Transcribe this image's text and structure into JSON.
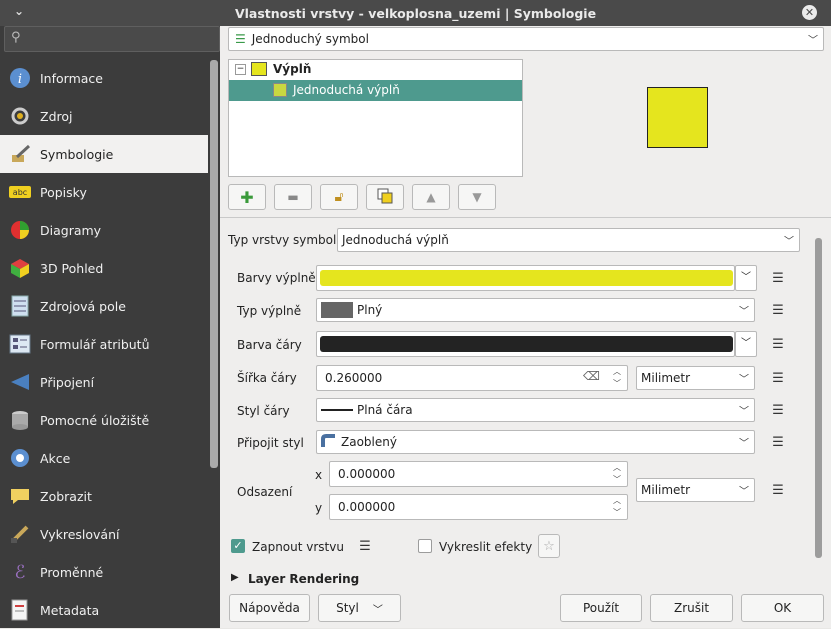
{
  "window": {
    "title": "Vlastnosti vrstvy - velkoplosna_uzemi | Symbologie"
  },
  "sidebar": {
    "items": [
      {
        "label": "Informace",
        "icon": "info-icon"
      },
      {
        "label": "Zdroj",
        "icon": "source-icon"
      },
      {
        "label": "Symbologie",
        "icon": "symbology-icon"
      },
      {
        "label": "Popisky",
        "icon": "labels-icon"
      },
      {
        "label": "Diagramy",
        "icon": "diagrams-icon"
      },
      {
        "label": "3D Pohled",
        "icon": "cube-3d-icon"
      },
      {
        "label": "Zdrojová pole",
        "icon": "fields-icon"
      },
      {
        "label": "Formulář atributů",
        "icon": "attributes-form-icon"
      },
      {
        "label": "Připojení",
        "icon": "joins-icon"
      },
      {
        "label": "Pomocné úložiště",
        "icon": "auxiliary-storage-icon"
      },
      {
        "label": "Akce",
        "icon": "actions-icon"
      },
      {
        "label": "Zobrazit",
        "icon": "display-icon"
      },
      {
        "label": "Vykreslování",
        "icon": "rendering-icon"
      },
      {
        "label": "Proměnné",
        "icon": "variables-icon"
      },
      {
        "label": "Metadata",
        "icon": "metadata-icon"
      }
    ],
    "active": "Symbologie"
  },
  "renderer": {
    "selected": "Jednoduchý symbol"
  },
  "tree": {
    "root": "Výplň",
    "child": "Jednoduchá výplň"
  },
  "symbol_type": {
    "label": "Typ vrstvy symbolů",
    "value": "Jednoduchá výplň"
  },
  "props": {
    "fill_color": {
      "label": "Barvy výplně",
      "color": "#e5e51e"
    },
    "fill_style": {
      "label": "Typ výplně",
      "value": "Plný"
    },
    "stroke_color": {
      "label": "Barva čáry",
      "color": "#232323"
    },
    "stroke_width": {
      "label": "Šířka čáry",
      "value": "0.260000",
      "unit": "Milimetr"
    },
    "stroke_style": {
      "label": "Styl čáry",
      "value": "Plná čára"
    },
    "join_style": {
      "label": "Připojit styl",
      "value": "Zaoblený"
    },
    "offset": {
      "label": "Odsazení",
      "x_label": "x",
      "y_label": "y",
      "x": "0.000000",
      "y": "0.000000",
      "unit": "Milimetr"
    }
  },
  "checks": {
    "enable_layer": "Zapnout vrstvu",
    "draw_effects": "Vykreslit efekty"
  },
  "section": {
    "layer_rendering": "Layer Rendering"
  },
  "buttons": {
    "help": "Nápověda",
    "style": "Styl",
    "apply": "Použít",
    "cancel": "Zrušit",
    "ok": "OK"
  },
  "colors": {
    "accent": "#4e9a8e",
    "fill": "#e5e51e",
    "check": "#4e9a8e"
  }
}
